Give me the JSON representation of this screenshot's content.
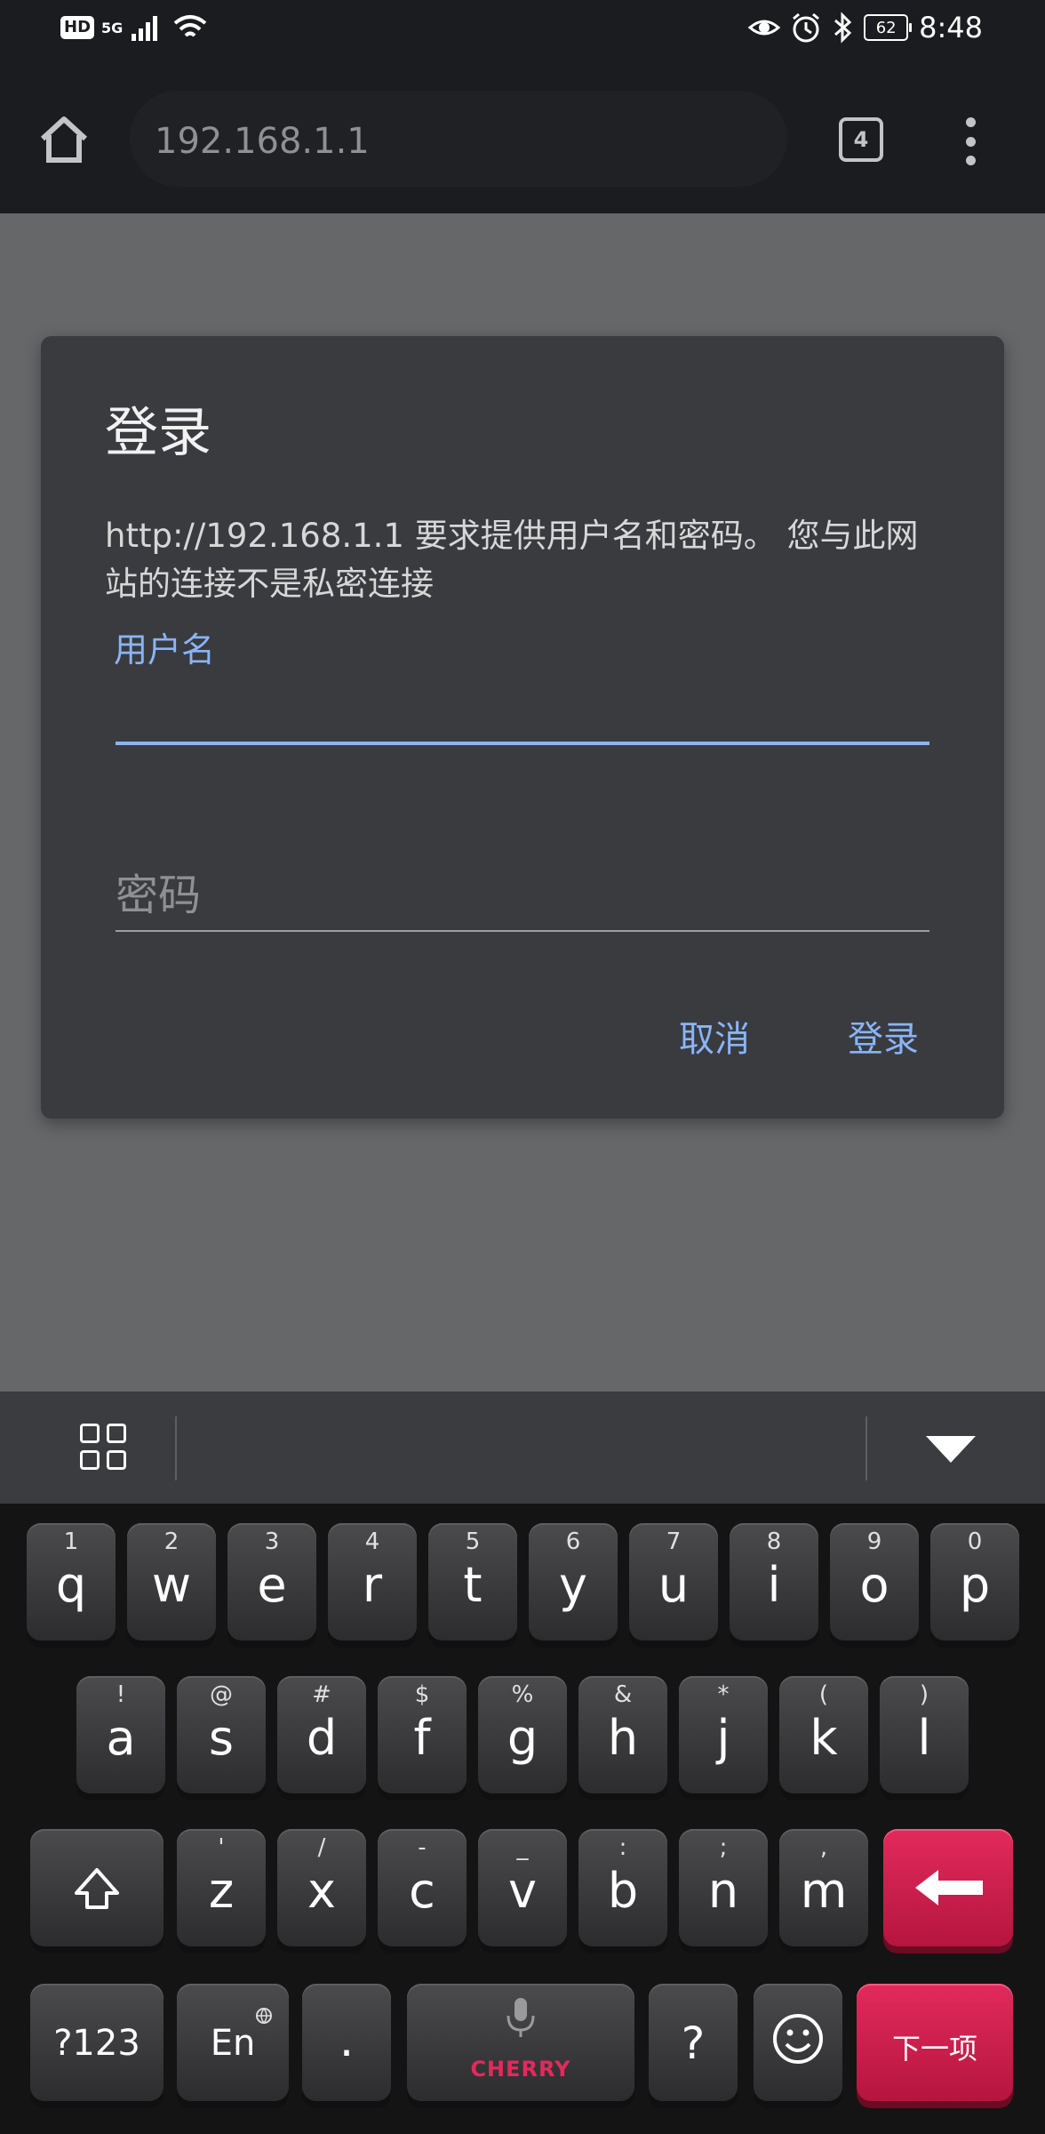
{
  "status_bar": {
    "hd": "HD",
    "network": "5G",
    "battery": "62",
    "time": "8:48"
  },
  "browser": {
    "url": "192.168.1.1",
    "tab_count": "4"
  },
  "dialog": {
    "title": "登录",
    "message": "http://192.168.1.1 要求提供用户名和密码。 您与此网站的连接不是私密连接",
    "username_label": "用户名",
    "username_value": "",
    "password_placeholder": "密码",
    "cancel_label": "取消",
    "login_label": "登录"
  },
  "keyboard": {
    "row1": [
      {
        "num": "1",
        "letter": "q"
      },
      {
        "num": "2",
        "letter": "w"
      },
      {
        "num": "3",
        "letter": "e"
      },
      {
        "num": "4",
        "letter": "r"
      },
      {
        "num": "5",
        "letter": "t"
      },
      {
        "num": "6",
        "letter": "y"
      },
      {
        "num": "7",
        "letter": "u"
      },
      {
        "num": "8",
        "letter": "i"
      },
      {
        "num": "9",
        "letter": "o"
      },
      {
        "num": "0",
        "letter": "p"
      }
    ],
    "row2": [
      {
        "num": "!",
        "letter": "a"
      },
      {
        "num": "@",
        "letter": "s"
      },
      {
        "num": "#",
        "letter": "d"
      },
      {
        "num": "$",
        "letter": "f"
      },
      {
        "num": "%",
        "letter": "g"
      },
      {
        "num": "&",
        "letter": "h"
      },
      {
        "num": "*",
        "letter": "j"
      },
      {
        "num": "(",
        "letter": "k"
      },
      {
        "num": ")",
        "letter": "l"
      }
    ],
    "row3": [
      {
        "num": "'",
        "letter": "z"
      },
      {
        "num": "/",
        "letter": "x"
      },
      {
        "num": "-",
        "letter": "c"
      },
      {
        "num": "_",
        "letter": "v"
      },
      {
        "num": ":",
        "letter": "b"
      },
      {
        "num": ";",
        "letter": "n"
      },
      {
        "num": ",",
        "letter": "m"
      }
    ],
    "symbols_label": "?123",
    "lang_label": "En",
    "period_label": ".",
    "brand_label": "CHERRY",
    "question_label": "?",
    "next_label": "下一项"
  }
}
